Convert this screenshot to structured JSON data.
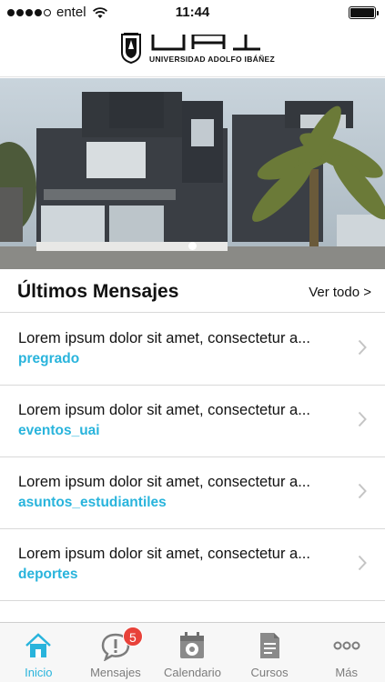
{
  "status_bar": {
    "carrier": "entel",
    "time": "11:44",
    "signal_bars": 4,
    "battery_level": 1.0
  },
  "header": {
    "logo_text": "UAI",
    "university_name": "UNIVERSIDAD ADOLFO IBÁÑEZ"
  },
  "banner": {
    "page_count": 1,
    "current_page": 1
  },
  "section": {
    "title": "Últimos Mensajes",
    "see_all_label": "Ver todo >"
  },
  "messages": [
    {
      "title": "Lorem ipsum dolor sit amet, consectetur a...",
      "tag": "pregrado"
    },
    {
      "title": "Lorem ipsum dolor sit amet, consectetur a...",
      "tag": "eventos_uai"
    },
    {
      "title": "Lorem ipsum dolor sit amet, consectetur a...",
      "tag": "asuntos_estudiantiles"
    },
    {
      "title": "Lorem ipsum dolor sit amet, consectetur a...",
      "tag": "deportes"
    }
  ],
  "tab_bar": {
    "tabs": [
      {
        "label": "Inicio",
        "icon": "home-icon",
        "active": true
      },
      {
        "label": "Mensajes",
        "icon": "chat-alert-icon",
        "badge": "5"
      },
      {
        "label": "Calendario",
        "icon": "calendar-icon"
      },
      {
        "label": "Cursos",
        "icon": "document-icon"
      },
      {
        "label": "Más",
        "icon": "more-icon"
      }
    ]
  },
  "colors": {
    "accent": "#29b4dc",
    "badge": "#e8423a",
    "tab_inactive": "#7c7c7c"
  }
}
